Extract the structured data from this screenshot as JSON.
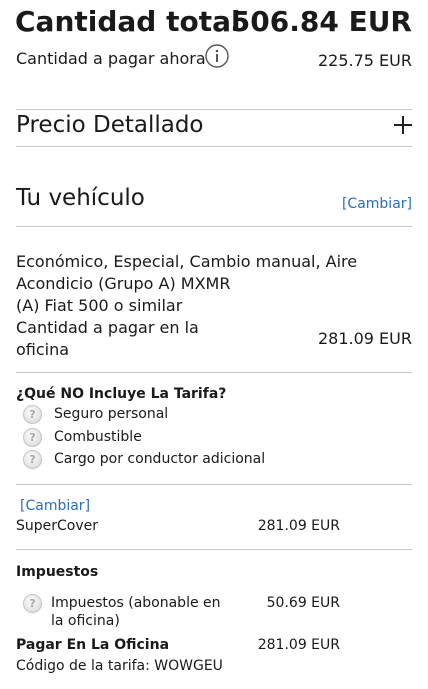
{
  "summary": {
    "total_label": "Cantidad total",
    "total_amount": "506.84 EUR",
    "pay_now_label": "Cantidad a pagar ahora",
    "pay_now_amount": "225.75 EUR"
  },
  "detailed": {
    "title": "Precio Detallado",
    "expand_symbol": "+"
  },
  "vehicle": {
    "title": "Tu vehículo",
    "change_link": "[Cambiar]",
    "desc_line1": "Económico, Especial, Cambio manual, Aire",
    "desc_line2": "Acondicio (Grupo A) MXMR",
    "desc_line3": "(A) Fiat 500 o similar",
    "office_label_line1": "Cantidad a pagar en la",
    "office_label_line2": "oficina",
    "office_amount": "281.09 EUR"
  },
  "not_included": {
    "title": "¿Qué NO Incluye La Tarifa?",
    "items": [
      {
        "label": "Seguro personal",
        "icon": "question-icon"
      },
      {
        "label": "Combustible",
        "icon": "question-icon"
      },
      {
        "label": "Cargo por conductor adicional",
        "icon": "question-icon"
      }
    ]
  },
  "coverage": {
    "change_link": "[Cambiar]",
    "name": "SuperCover",
    "amount": "281.09 EUR"
  },
  "taxes": {
    "title": "Impuestos",
    "item_line1": "Impuestos (abonable en",
    "item_line2": "la oficina)",
    "item_amount": "50.69 EUR",
    "pay_office_label": "Pagar En La Oficina",
    "pay_office_amount": "281.09 EUR",
    "rate_code": "Código de la tarifa: WOWGEU"
  },
  "colors": {
    "link": "#2a6ebb",
    "divider": "#c9c9c9",
    "text": "#1a1a1a"
  }
}
